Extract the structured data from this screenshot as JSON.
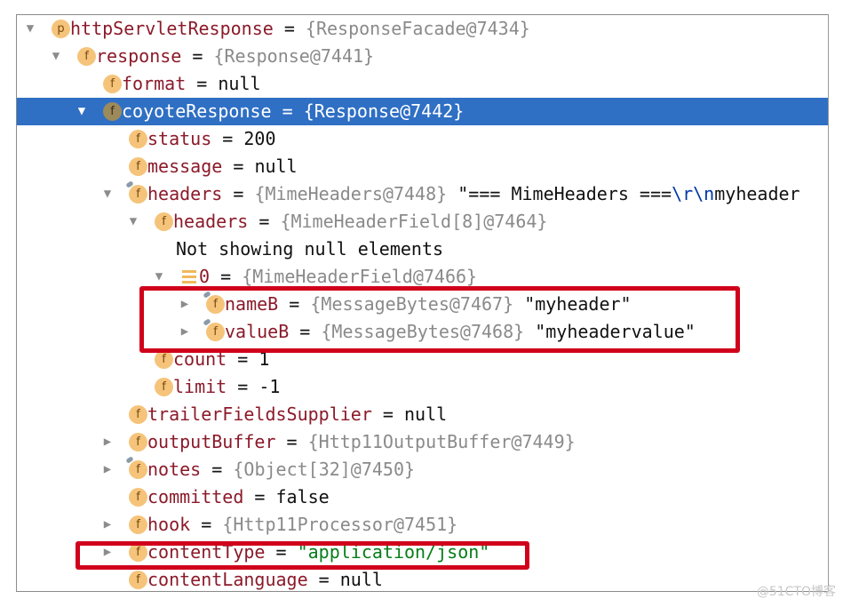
{
  "rows": [
    {
      "level": 0,
      "expand": "expanded",
      "icon": "p",
      "name": "httpServletResponse",
      "type": "{ResponseFacade@7434}"
    },
    {
      "level": 1,
      "expand": "expanded",
      "icon": "f",
      "name": "response",
      "type": "{Response@7441}"
    },
    {
      "level": 2,
      "expand": "none",
      "icon": "f",
      "name": "format",
      "value": "null"
    },
    {
      "level": 2,
      "expand": "expanded",
      "icon": "f",
      "name": "coyoteResponse",
      "type": "{Response@7442}",
      "selected": true
    },
    {
      "level": 3,
      "expand": "none",
      "icon": "f",
      "name": "status",
      "value": "200"
    },
    {
      "level": 3,
      "expand": "none",
      "icon": "f",
      "name": "message",
      "value": "null"
    },
    {
      "level": 3,
      "expand": "expanded",
      "icon": "f",
      "badge": true,
      "name": "headers",
      "type": "{MimeHeaders@7448}",
      "value": "\"=== MimeHeaders ===",
      "escape": "\\r\\n",
      "value_post": "myheader"
    },
    {
      "level": 4,
      "expand": "expanded",
      "icon": "f",
      "name": "headers",
      "type": "{MimeHeaderField[8]@7464}"
    },
    {
      "level": 5,
      "expand": "none",
      "icon": "none",
      "note": "Not showing null elements"
    },
    {
      "level": 5,
      "expand": "expanded",
      "icon": "array",
      "name": "0",
      "type": "{MimeHeaderField@7466}"
    },
    {
      "level": 6,
      "expand": "collapsed",
      "icon": "f",
      "badge": true,
      "name": "nameB",
      "type": "{MessageBytes@7467}",
      "value": "\"myheader\""
    },
    {
      "level": 6,
      "expand": "collapsed",
      "icon": "f",
      "badge": true,
      "name": "valueB",
      "type": "{MessageBytes@7468}",
      "value": "\"myheadervalue\""
    },
    {
      "level": 4,
      "expand": "none",
      "icon": "f",
      "name": "count",
      "value": "1"
    },
    {
      "level": 4,
      "expand": "none",
      "icon": "f",
      "name": "limit",
      "value": "-1"
    },
    {
      "level": 3,
      "expand": "none",
      "icon": "f",
      "name": "trailerFieldsSupplier",
      "value": "null"
    },
    {
      "level": 3,
      "expand": "collapsed",
      "icon": "f",
      "name": "outputBuffer",
      "type": "{Http11OutputBuffer@7449}"
    },
    {
      "level": 3,
      "expand": "collapsed",
      "icon": "f",
      "badge": true,
      "name": "notes",
      "type": "{Object[32]@7450}"
    },
    {
      "level": 3,
      "expand": "none",
      "icon": "f",
      "name": "committed",
      "value": "false"
    },
    {
      "level": 3,
      "expand": "collapsed",
      "icon": "f",
      "name": "hook",
      "type": "{Http11Processor@7451}"
    },
    {
      "level": 3,
      "expand": "collapsed",
      "icon": "f",
      "name": "contentType",
      "string_value": "\"application/json\""
    },
    {
      "level": 3,
      "expand": "none",
      "icon": "f",
      "name": "contentLanguage",
      "value": "null"
    }
  ],
  "equals": "=",
  "watermark": "@51CTO博客",
  "colors": {
    "selection": "#2f6fc4",
    "field_name": "#8b1a2a",
    "type": "#8a8a8a",
    "string": "#067d17",
    "highlight_box": "#d0021b"
  }
}
